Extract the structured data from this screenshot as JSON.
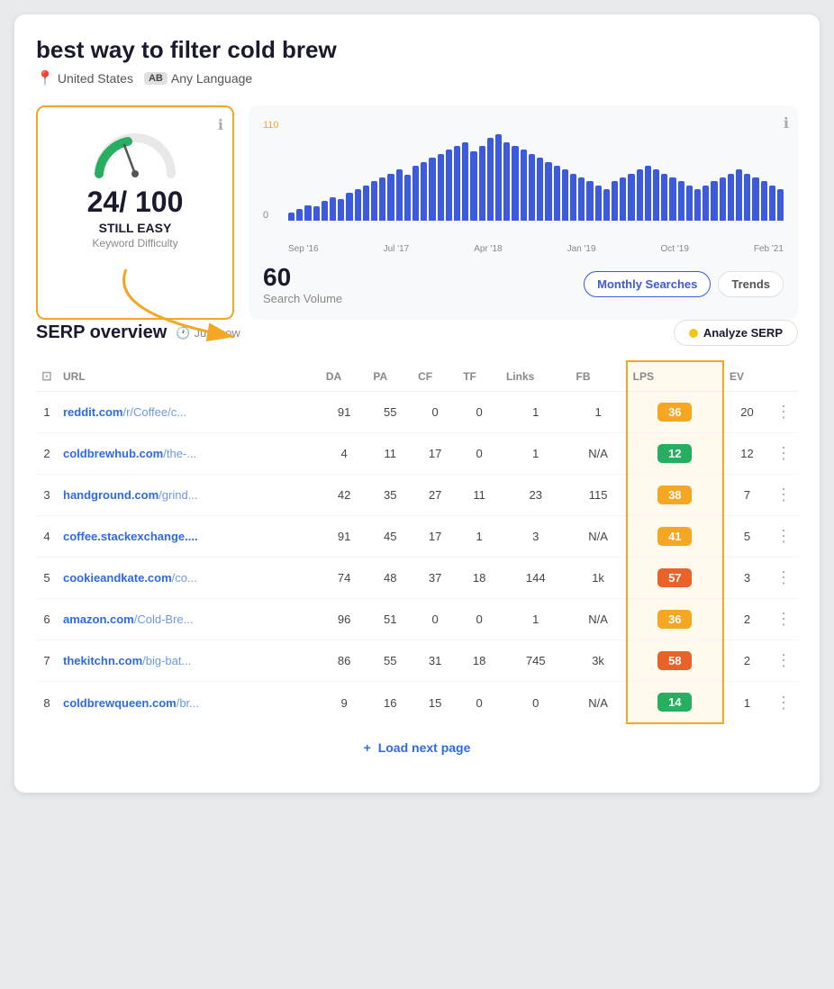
{
  "page": {
    "title": "best way to filter cold brew",
    "location": "United States",
    "lang_badge": "AB",
    "lang_label": "Any Language"
  },
  "kd_card": {
    "score": "24",
    "out_of": "/ 100",
    "difficulty_label": "STILL EASY",
    "difficulty_sublabel": "Keyword Difficulty",
    "info_icon": "ℹ"
  },
  "chart": {
    "info_icon": "ℹ",
    "y_max": "110",
    "y_min": "0",
    "x_labels": [
      "Sep '16",
      "Jul '17",
      "Apr '18",
      "Jan '19",
      "Oct '19",
      "Feb '21"
    ],
    "bars": [
      10,
      15,
      20,
      18,
      25,
      30,
      28,
      35,
      40,
      45,
      50,
      55,
      60,
      65,
      58,
      70,
      75,
      80,
      85,
      90,
      95,
      100,
      88,
      95,
      105,
      110,
      100,
      95,
      90,
      85,
      80,
      75,
      70,
      65,
      60,
      55,
      50,
      45,
      40,
      50,
      55,
      60,
      65,
      70,
      65,
      60,
      55,
      50,
      45,
      40,
      45,
      50,
      55,
      60,
      65,
      60,
      55,
      50,
      45,
      40
    ],
    "search_volume": "60",
    "search_volume_label": "Search Volume",
    "tab_monthly": "Monthly Searches",
    "tab_trends": "Trends"
  },
  "serp": {
    "title": "SERP overview",
    "time_label": "Just now",
    "analyze_btn": "Analyze SERP",
    "columns": [
      "",
      "URL",
      "DA",
      "PA",
      "CF",
      "TF",
      "Links",
      "FB",
      "LPS",
      "EV",
      ""
    ],
    "rows": [
      {
        "rank": "1",
        "domain": "reddit.com",
        "path": "/r/Coffee/c...",
        "da": "91",
        "pa": "55",
        "cf": "0",
        "tf": "0",
        "links": "1",
        "fb": "1",
        "lps": "36",
        "lps_color": "orange",
        "ev": "20"
      },
      {
        "rank": "2",
        "domain": "coldbrewhub.com",
        "path": "/the-...",
        "da": "4",
        "pa": "11",
        "cf": "17",
        "tf": "0",
        "links": "1",
        "fb": "N/A",
        "lps": "12",
        "lps_color": "green",
        "ev": "12"
      },
      {
        "rank": "3",
        "domain": "handground.com",
        "path": "/grind...",
        "da": "42",
        "pa": "35",
        "cf": "27",
        "tf": "11",
        "links": "23",
        "fb": "115",
        "lps": "38",
        "lps_color": "orange",
        "ev": "7"
      },
      {
        "rank": "4",
        "domain": "coffee.stackexchange....",
        "path": "",
        "da": "91",
        "pa": "45",
        "cf": "17",
        "tf": "1",
        "links": "3",
        "fb": "N/A",
        "lps": "41",
        "lps_color": "orange",
        "ev": "5"
      },
      {
        "rank": "5",
        "domain": "cookieandkate.com",
        "path": "/co...",
        "da": "74",
        "pa": "48",
        "cf": "37",
        "tf": "18",
        "links": "144",
        "fb": "1k",
        "lps": "57",
        "lps_color": "red-orange",
        "ev": "3"
      },
      {
        "rank": "6",
        "domain": "amazon.com",
        "path": "/Cold-Bre...",
        "da": "96",
        "pa": "51",
        "cf": "0",
        "tf": "0",
        "links": "1",
        "fb": "N/A",
        "lps": "36",
        "lps_color": "orange",
        "ev": "2"
      },
      {
        "rank": "7",
        "domain": "thekitchn.com",
        "path": "/big-bat...",
        "da": "86",
        "pa": "55",
        "cf": "31",
        "tf": "18",
        "links": "745",
        "fb": "3k",
        "lps": "58",
        "lps_color": "red-orange",
        "ev": "2"
      },
      {
        "rank": "8",
        "domain": "coldbrewqueen.com",
        "path": "/br...",
        "da": "9",
        "pa": "16",
        "cf": "15",
        "tf": "0",
        "links": "0",
        "fb": "N/A",
        "lps": "14",
        "lps_color": "green",
        "ev": "1"
      }
    ],
    "load_next": "Load next page"
  }
}
